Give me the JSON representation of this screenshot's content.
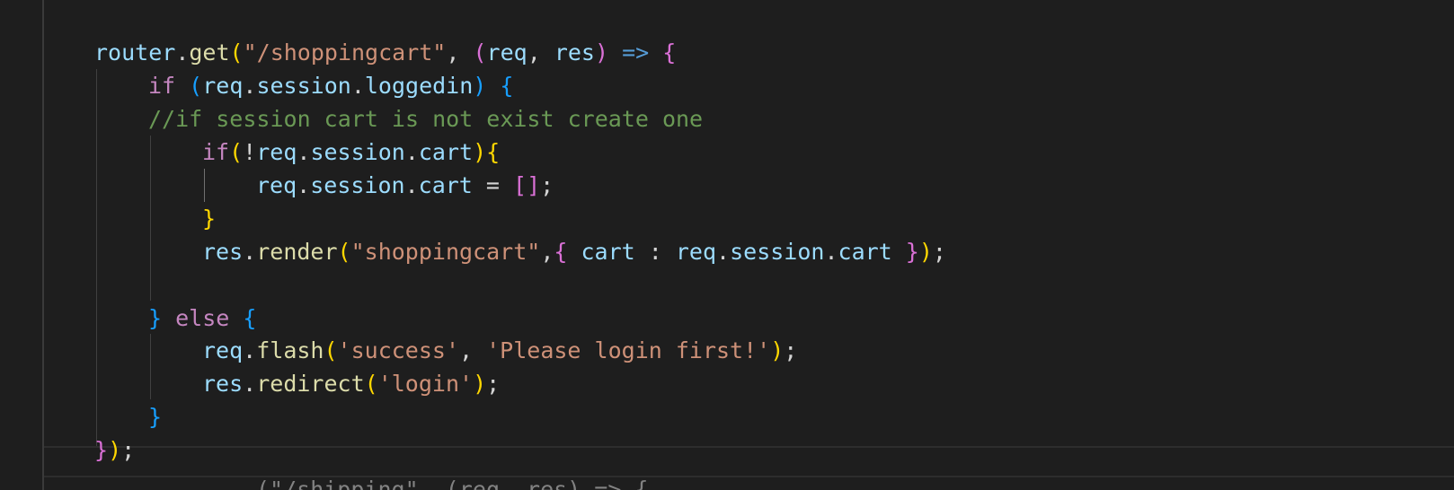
{
  "editor": {
    "theme": "dark",
    "colors": {
      "background": "#1e1e1e",
      "keyword": "#c586c0",
      "variable": "#9cdcfe",
      "function": "#dcdcaa",
      "string": "#ce9178",
      "comment": "#6a9955",
      "bracket_level_1": "#ffd700",
      "bracket_level_2": "#da70d6",
      "bracket_level_3": "#179fff"
    },
    "lines": [
      [
        {
          "t": "router",
          "c": "t-var"
        },
        {
          "t": ".",
          "c": "t-op"
        },
        {
          "t": "get",
          "c": "t-fn"
        },
        {
          "t": "(",
          "c": "b1"
        },
        {
          "t": "\"/shoppingcart\"",
          "c": "t-str"
        },
        {
          "t": ", ",
          "c": "t-op"
        },
        {
          "t": "(",
          "c": "b2"
        },
        {
          "t": "req",
          "c": "t-var"
        },
        {
          "t": ", ",
          "c": "t-op"
        },
        {
          "t": "res",
          "c": "t-var"
        },
        {
          "t": ")",
          "c": "b2"
        },
        {
          "t": " ",
          "c": "t-op"
        },
        {
          "t": "=>",
          "c": "t-arrow"
        },
        {
          "t": " ",
          "c": "t-op"
        },
        {
          "t": "{",
          "c": "b2"
        }
      ],
      [
        {
          "t": "if",
          "c": "t-kw"
        },
        {
          "t": " ",
          "c": "t-op"
        },
        {
          "t": "(",
          "c": "b3"
        },
        {
          "t": "req",
          "c": "t-var"
        },
        {
          "t": ".",
          "c": "t-op"
        },
        {
          "t": "session",
          "c": "t-var"
        },
        {
          "t": ".",
          "c": "t-op"
        },
        {
          "t": "loggedin",
          "c": "t-var"
        },
        {
          "t": ")",
          "c": "b3"
        },
        {
          "t": " ",
          "c": "t-op"
        },
        {
          "t": "{",
          "c": "b3"
        }
      ],
      [
        {
          "t": "//if session cart is not exist create one",
          "c": "t-cmt"
        }
      ],
      [
        {
          "t": "if",
          "c": "t-kw"
        },
        {
          "t": "(",
          "c": "b1"
        },
        {
          "t": "!",
          "c": "t-op"
        },
        {
          "t": "req",
          "c": "t-var"
        },
        {
          "t": ".",
          "c": "t-op"
        },
        {
          "t": "session",
          "c": "t-var"
        },
        {
          "t": ".",
          "c": "t-op"
        },
        {
          "t": "cart",
          "c": "t-var"
        },
        {
          "t": ")",
          "c": "b1"
        },
        {
          "t": "{",
          "c": "b1"
        }
      ],
      [
        {
          "t": "req",
          "c": "t-var"
        },
        {
          "t": ".",
          "c": "t-op"
        },
        {
          "t": "session",
          "c": "t-var"
        },
        {
          "t": ".",
          "c": "t-op"
        },
        {
          "t": "cart",
          "c": "t-var"
        },
        {
          "t": " = ",
          "c": "t-op"
        },
        {
          "t": "[]",
          "c": "b2"
        },
        {
          "t": ";",
          "c": "t-op"
        }
      ],
      [
        {
          "t": "}",
          "c": "b1"
        }
      ],
      [
        {
          "t": "res",
          "c": "t-var"
        },
        {
          "t": ".",
          "c": "t-op"
        },
        {
          "t": "render",
          "c": "t-fn"
        },
        {
          "t": "(",
          "c": "b1"
        },
        {
          "t": "\"shoppingcart\"",
          "c": "t-str"
        },
        {
          "t": ",",
          "c": "t-op"
        },
        {
          "t": "{",
          "c": "b2"
        },
        {
          "t": " ",
          "c": "t-op"
        },
        {
          "t": "cart",
          "c": "t-var"
        },
        {
          "t": " : ",
          "c": "t-op"
        },
        {
          "t": "req",
          "c": "t-var"
        },
        {
          "t": ".",
          "c": "t-op"
        },
        {
          "t": "session",
          "c": "t-var"
        },
        {
          "t": ".",
          "c": "t-op"
        },
        {
          "t": "cart",
          "c": "t-var"
        },
        {
          "t": " ",
          "c": "t-op"
        },
        {
          "t": "}",
          "c": "b2"
        },
        {
          "t": ")",
          "c": "b1"
        },
        {
          "t": ";",
          "c": "t-op"
        }
      ],
      [],
      [
        {
          "t": "}",
          "c": "b3"
        },
        {
          "t": " ",
          "c": "t-op"
        },
        {
          "t": "else",
          "c": "t-kw"
        },
        {
          "t": " ",
          "c": "t-op"
        },
        {
          "t": "{",
          "c": "b3"
        }
      ],
      [
        {
          "t": "req",
          "c": "t-var"
        },
        {
          "t": ".",
          "c": "t-op"
        },
        {
          "t": "flash",
          "c": "t-fn"
        },
        {
          "t": "(",
          "c": "b1"
        },
        {
          "t": "'success'",
          "c": "t-str"
        },
        {
          "t": ", ",
          "c": "t-op"
        },
        {
          "t": "'Please login first!'",
          "c": "t-str"
        },
        {
          "t": ")",
          "c": "b1"
        },
        {
          "t": ";",
          "c": "t-op"
        }
      ],
      [
        {
          "t": "res",
          "c": "t-var"
        },
        {
          "t": ".",
          "c": "t-op"
        },
        {
          "t": "redirect",
          "c": "t-fn"
        },
        {
          "t": "(",
          "c": "b1"
        },
        {
          "t": "'login'",
          "c": "t-str"
        },
        {
          "t": ")",
          "c": "b1"
        },
        {
          "t": ";",
          "c": "t-op"
        }
      ],
      [
        {
          "t": "}",
          "c": "b3"
        }
      ],
      [
        {
          "t": "}",
          "c": "b2"
        },
        {
          "t": ")",
          "c": "b1"
        },
        {
          "t": ";",
          "c": "t-op"
        }
      ],
      [
        {
          "t": "(\"/shipping\", (req, res) => {",
          "c": "t-op fade"
        }
      ]
    ]
  }
}
